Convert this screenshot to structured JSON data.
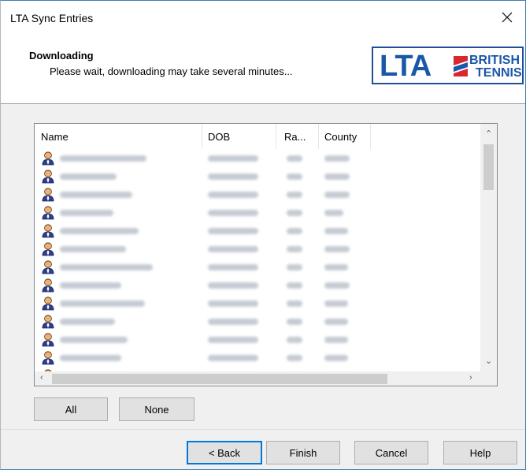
{
  "window": {
    "title": "LTA Sync Entries",
    "close_icon": "close-icon"
  },
  "header": {
    "title": "Downloading",
    "subtitle": "Please wait, downloading may take several minutes...",
    "logo": {
      "lta": "LTA",
      "line1": "BRITISH",
      "line2": "TENNIS",
      "brand_color": "#1a57a8"
    }
  },
  "list": {
    "columns": [
      "Name",
      "DOB",
      "Ra...",
      "County"
    ],
    "row_icon": "person-icon",
    "row_count_visible": 13,
    "rows_redacted": true
  },
  "buttons": {
    "all": "All",
    "none": "None",
    "back": "< Back",
    "finish": "Finish",
    "cancel": "Cancel",
    "help": "Help"
  }
}
